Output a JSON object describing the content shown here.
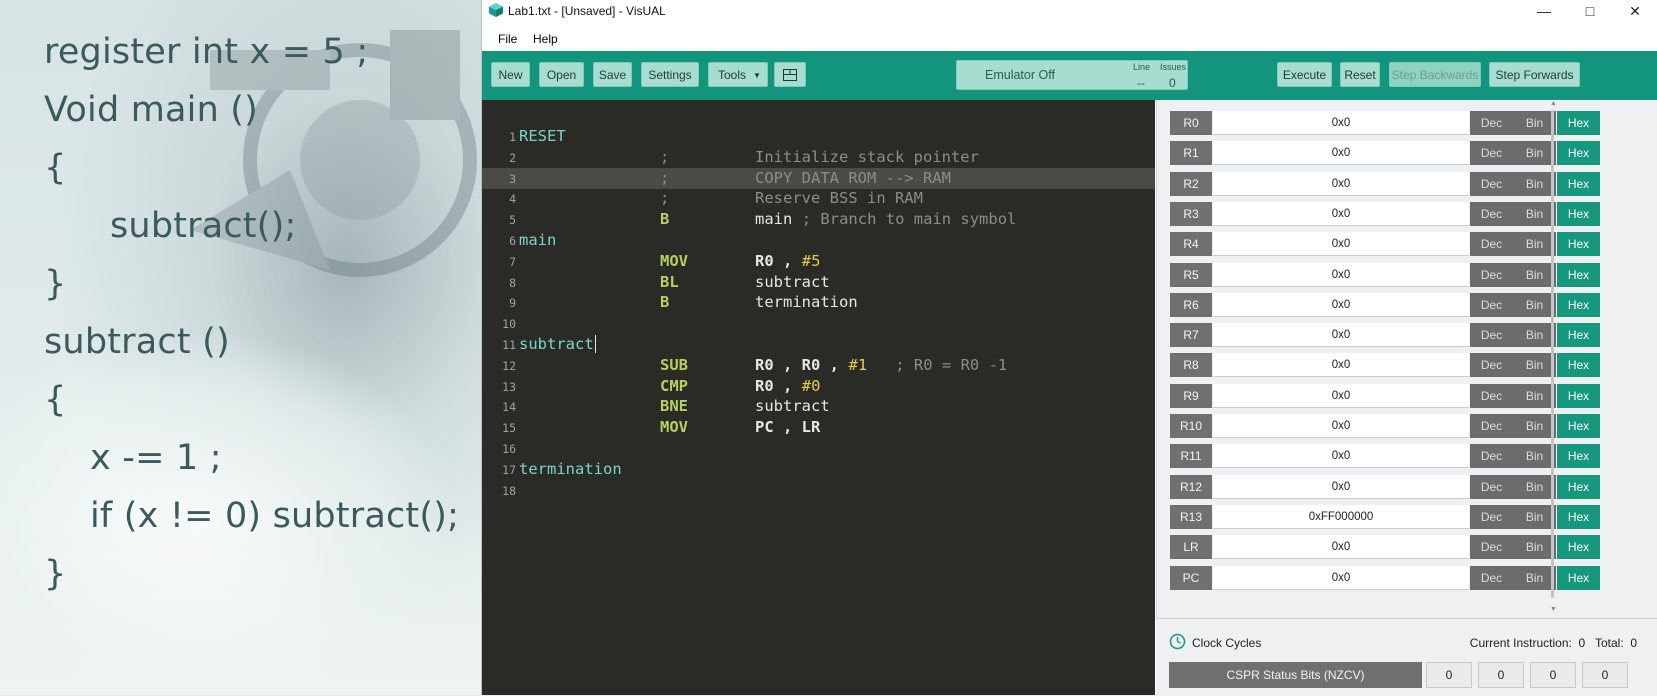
{
  "slide": {
    "lines": [
      "register int x = 5 ;",
      "Void main ()",
      "{",
      "subtract();",
      "}",
      "subtract ()",
      "{",
      "x -= 1 ;",
      "if (x != 0) subtract();",
      "}"
    ]
  },
  "window": {
    "title": "Lab1.txt - [Unsaved] - VisUAL",
    "controls": {
      "minimize": "—",
      "maximize": "□",
      "close": "✕"
    }
  },
  "menu": {
    "file": "File",
    "help": "Help"
  },
  "toolbar": {
    "new": "New",
    "open": "Open",
    "save": "Save",
    "settings": "Settings",
    "tools": "Tools",
    "status": "Emulator Off",
    "line_label": "Line",
    "issues_label": "Issues",
    "line_value": "--",
    "issues_value": "0",
    "execute": "Execute",
    "reset": "Reset",
    "step_backwards": "Step Backwards",
    "step_forwards": "Step Forwards"
  },
  "editor": {
    "lines": [
      {
        "n": "1",
        "label": "RESET"
      },
      {
        "n": "2",
        "op": ";",
        "op_style": "comment",
        "arg": "Initialize stack pointer",
        "arg_style": "comment"
      },
      {
        "n": "3",
        "op": ";",
        "op_style": "comment",
        "arg": "COPY DATA ROM --> RAM",
        "arg_style": "comment"
      },
      {
        "n": "4",
        "op": ";",
        "op_style": "comment",
        "arg": "Reserve BSS in RAM",
        "arg_style": "comment"
      },
      {
        "n": "5",
        "op": "B",
        "arg": "main",
        "comment": "; Branch to main symbol"
      },
      {
        "n": "6",
        "label": "main"
      },
      {
        "n": "7",
        "op": "MOV",
        "reg": "R0 , ",
        "num": "#5"
      },
      {
        "n": "8",
        "op": "BL",
        "arg": "subtract"
      },
      {
        "n": "9",
        "op": "B",
        "arg": "termination"
      },
      {
        "n": "10"
      },
      {
        "n": "11",
        "label": "subtract"
      },
      {
        "n": "12",
        "op": "SUB",
        "reg": "R0 , R0 , ",
        "num": "#1",
        "comment": "; R0 = R0 -1"
      },
      {
        "n": "13",
        "op": "CMP",
        "reg": "R0 , ",
        "num": "#0"
      },
      {
        "n": "14",
        "op": "BNE",
        "arg": "subtract"
      },
      {
        "n": "15",
        "op": "MOV",
        "reg": "PC , LR"
      },
      {
        "n": "16"
      },
      {
        "n": "17",
        "label": "termination"
      },
      {
        "n": "18"
      }
    ]
  },
  "registers": [
    {
      "name": "R0",
      "value": "0x0"
    },
    {
      "name": "R1",
      "value": "0x0"
    },
    {
      "name": "R2",
      "value": "0x0"
    },
    {
      "name": "R3",
      "value": "0x0"
    },
    {
      "name": "R4",
      "value": "0x0"
    },
    {
      "name": "R5",
      "value": "0x0"
    },
    {
      "name": "R6",
      "value": "0x0"
    },
    {
      "name": "R7",
      "value": "0x0"
    },
    {
      "name": "R8",
      "value": "0x0"
    },
    {
      "name": "R9",
      "value": "0x0"
    },
    {
      "name": "R10",
      "value": "0x0"
    },
    {
      "name": "R11",
      "value": "0x0"
    },
    {
      "name": "R12",
      "value": "0x0"
    },
    {
      "name": "R13",
      "value": "0xFF000000"
    },
    {
      "name": "LR",
      "value": "0x0"
    },
    {
      "name": "PC",
      "value": "0x0"
    }
  ],
  "format_buttons": {
    "dec": "Dec",
    "bin": "Bin",
    "hex": "Hex",
    "selected": "hex"
  },
  "bottom": {
    "clock_cycles": "Clock Cycles",
    "current_instruction": "Current Instruction:  0   Total:  0",
    "cspr_label": "CSPR Status Bits (NZCV)",
    "bits": [
      "0",
      "0",
      "0",
      "0"
    ]
  },
  "colors": {
    "accent": "#13947d",
    "editor_bg": "#2a2b26",
    "opcode": "#b6d060",
    "label": "#7bd4c9",
    "number": "#eacb4a"
  }
}
